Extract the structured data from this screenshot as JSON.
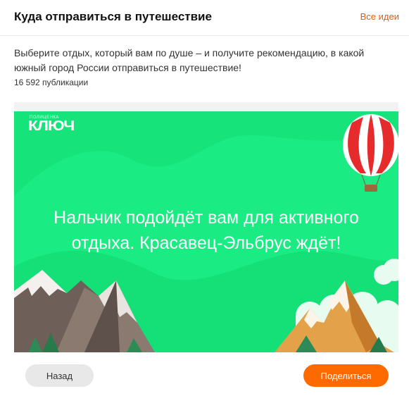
{
  "header": {
    "title": "Куда отправиться в путешествие",
    "all_ideas_link": "Все идеи"
  },
  "description": "Выберите отдых, который вам по душе – и получите рекомендацию, в какой южный город России отправиться в путешествие!",
  "publications_count": "16 592 публикации",
  "banner": {
    "logo_small": "ПОЛИЦЕНКА",
    "logo": "КЛЮЧ",
    "headline_line1": "Нальчик подойдёт вам для активного",
    "headline_line2": "отдыха. Красавец-Эльбрус ждёт!",
    "background_color": "#16e47a"
  },
  "actions": {
    "back_label": "Назад",
    "share_label": "Поделиться",
    "share_color": "#ff6a00"
  }
}
